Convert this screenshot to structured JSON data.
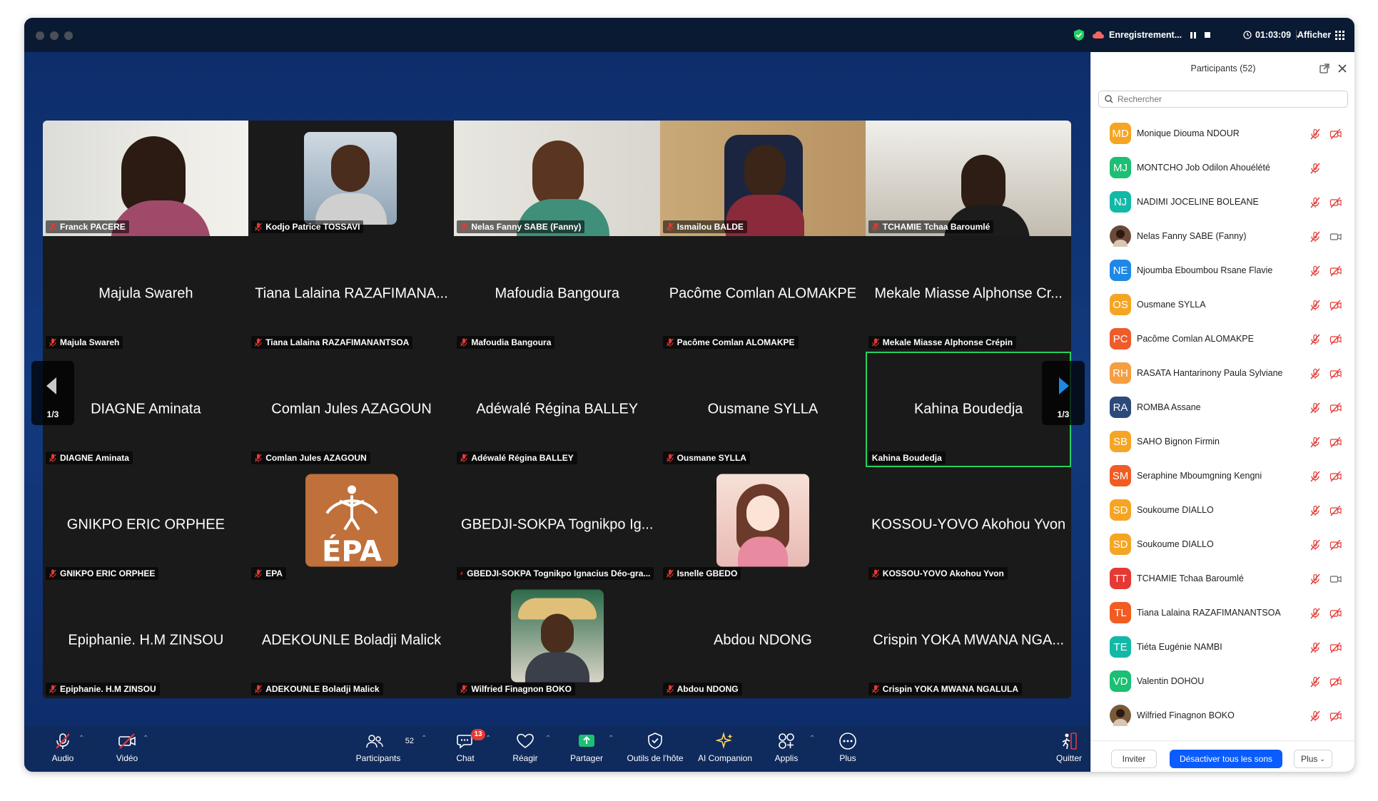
{
  "titlebar": {
    "recording_label": "Enregistrement...",
    "timer": "01:03:09",
    "view_label": "Afficher"
  },
  "gallery": {
    "page_left": "1/3",
    "page_right": "1/3",
    "tiles": [
      {
        "display": "",
        "tag": "Franck PACERE"
      },
      {
        "display": "",
        "tag": "Kodjo Patrice TOSSAVI"
      },
      {
        "display": "",
        "tag": "Nelas Fanny SABE (Fanny)"
      },
      {
        "display": "",
        "tag": "Ismailou BALDE"
      },
      {
        "display": "",
        "tag": "TCHAMIE Tchaa Baroumlé"
      },
      {
        "display": "Majula Swareh",
        "tag": "Majula Swareh"
      },
      {
        "display": "Tiana Lalaina RAZAFIMANA...",
        "tag": "Tiana Lalaina RAZAFIMANANTSOA"
      },
      {
        "display": "Mafoudia Bangoura",
        "tag": "Mafoudia Bangoura"
      },
      {
        "display": "Pacôme Comlan ALOMAKPE",
        "tag": "Pacôme Comlan ALOMAKPE"
      },
      {
        "display": "Mekale Miasse Alphonse Cr...",
        "tag": "Mekale Miasse Alphonse Crépin"
      },
      {
        "display": "DIAGNE Aminata",
        "tag": "DIAGNE Aminata"
      },
      {
        "display": "Comlan Jules AZAGOUN",
        "tag": "Comlan Jules AZAGOUN"
      },
      {
        "display": "Adéwalé Régina BALLEY",
        "tag": "Adéwalé Régina BALLEY"
      },
      {
        "display": "Ousmane SYLLA",
        "tag": "Ousmane SYLLA"
      },
      {
        "display": "Kahina Boudedja",
        "tag": "Kahina Boudedja"
      },
      {
        "display": "GNIKPO ERIC ORPHEE",
        "tag": "GNIKPO ERIC ORPHEE"
      },
      {
        "display": "ÉPA",
        "tag": "EPA"
      },
      {
        "display": "GBEDJI-SOKPA Tognikpo Ig...",
        "tag": "GBEDJI-SOKPA Tognikpo Ignacius Déo-gra..."
      },
      {
        "display": "",
        "tag": "Isnelle GBEDO"
      },
      {
        "display": "KOSSOU-YOVO Akohou Yvon",
        "tag": "KOSSOU-YOVO Akohou Yvon"
      },
      {
        "display": "Epiphanie. H.M ZINSOU",
        "tag": "Epiphanie. H.M ZINSOU"
      },
      {
        "display": "ADEKOUNLE Boladji Malick",
        "tag": "ADEKOUNLE Boladji Malick"
      },
      {
        "display": "",
        "tag": "Wilfried Finagnon BOKO"
      },
      {
        "display": "Abdou NDONG",
        "tag": "Abdou NDONG"
      },
      {
        "display": "Crispin YOKA MWANA NGA...",
        "tag": "Crispin YOKA MWANA NGALULA"
      }
    ]
  },
  "toolbar": {
    "audio": "Audio",
    "video": "Vidéo",
    "participants": "Participants",
    "participants_count": "52",
    "chat": "Chat",
    "chat_badge": "13",
    "react": "Réagir",
    "share": "Partager",
    "host_tools": "Outils de l'hôte",
    "ai": "AI Companion",
    "apps": "Applis",
    "more": "Plus",
    "leave": "Quitter"
  },
  "panel": {
    "title": "Participants (52)",
    "search_placeholder": "Rechercher",
    "participants": [
      {
        "initials": "MD",
        "name": "Monique Diouma NDOUR",
        "color": "#f5a524",
        "cam": "off"
      },
      {
        "initials": "MJ",
        "name": "MONTCHO Job Odilon Ahouélété",
        "color": "#1cbf73",
        "cam": "none"
      },
      {
        "initials": "NJ",
        "name": "NADIMI JOCELINE BOLEANE",
        "color": "#14b8a6",
        "cam": "off"
      },
      {
        "initials": "",
        "name": "Nelas Fanny SABE (Fanny)",
        "color": "#6b4a3a",
        "cam": "on"
      },
      {
        "initials": "NE",
        "name": "Njoumba Eboumbou Rsane Flavie",
        "color": "#1e88e5",
        "cam": "off"
      },
      {
        "initials": "OS",
        "name": "Ousmane SYLLA",
        "color": "#f5a524",
        "cam": "off"
      },
      {
        "initials": "PC",
        "name": "Pacôme Comlan ALOMAKPE",
        "color": "#ef5b2b",
        "cam": "off"
      },
      {
        "initials": "RH",
        "name": "RASATA Hantarinony Paula Sylviane",
        "color": "#f59e42",
        "cam": "off"
      },
      {
        "initials": "RA",
        "name": "ROMBA Assane",
        "color": "#2b4a7a",
        "cam": "off"
      },
      {
        "initials": "SB",
        "name": "SAHO Bignon Firmin",
        "color": "#f5a524",
        "cam": "off"
      },
      {
        "initials": "SM",
        "name": "Seraphine Mboumgning Kengni",
        "color": "#f25c22",
        "cam": "off"
      },
      {
        "initials": "SD",
        "name": "Soukoume DIALLO",
        "color": "#f5a524",
        "cam": "off"
      },
      {
        "initials": "SD",
        "name": "Soukoume DIALLO",
        "color": "#f5a524",
        "cam": "off"
      },
      {
        "initials": "TT",
        "name": "TCHAMIE Tchaa Baroumlé",
        "color": "#e53935",
        "cam": "on"
      },
      {
        "initials": "TL",
        "name": "Tiana Lalaina RAZAFIMANANTSOA",
        "color": "#f25c22",
        "cam": "off"
      },
      {
        "initials": "TE",
        "name": "Tiéta Eugénie NAMBI",
        "color": "#14b8a6",
        "cam": "off"
      },
      {
        "initials": "VD",
        "name": "Valentin DOHOU",
        "color": "#1cbf73",
        "cam": "off"
      },
      {
        "initials": "",
        "name": "Wilfried Finagnon BOKO",
        "color": "#7a5a3a",
        "cam": "off"
      }
    ],
    "invite": "Inviter",
    "mute_all": "Désactiver tous les sons",
    "more": "Plus"
  }
}
